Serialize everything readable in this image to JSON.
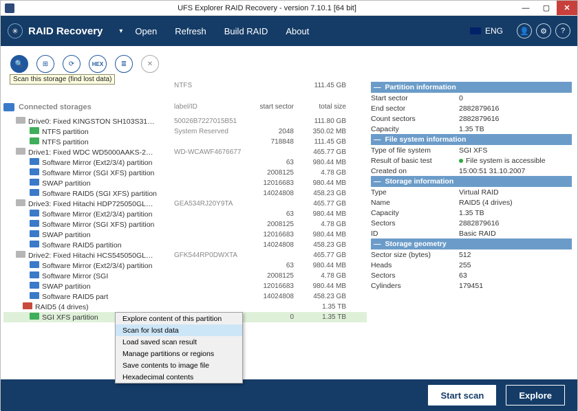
{
  "titlebar": {
    "title": "UFS Explorer RAID Recovery - version 7.10.1 [64 bit]"
  },
  "header": {
    "brand": "RAID Recovery",
    "menu": {
      "open": "Open",
      "refresh": "Refresh",
      "build": "Build RAID",
      "about": "About"
    },
    "lang": "ENG"
  },
  "tooltip": "Scan this storage (find lost data)",
  "tree": {
    "headers": {
      "label": "label/ID",
      "start": "start sector",
      "size": "total size"
    },
    "first_row": {
      "fs": "NTFS",
      "size": "111.45 GB"
    },
    "section": "Connected storages",
    "rows": [
      {
        "indent": "0",
        "ico": "ico-drive",
        "label": "Drive0: Fixed KINGSTON SH103S31…",
        "id": "50026B7227015B51",
        "start": "",
        "size": "111.80 GB"
      },
      {
        "indent": "1",
        "ico": "ico-part-g",
        "label": "NTFS partition",
        "id": "System Reserved",
        "start": "2048",
        "size": "350.02 MB"
      },
      {
        "indent": "1",
        "ico": "ico-part-g",
        "label": "NTFS partition",
        "id": "",
        "start": "718848",
        "size": "111.45 GB"
      },
      {
        "indent": "0",
        "ico": "ico-drive",
        "label": "Drive1: Fixed WDC WD5000AAKS-2…",
        "id": "WD-WCAWF4676677",
        "start": "",
        "size": "465.77 GB"
      },
      {
        "indent": "1",
        "ico": "ico-part-b",
        "label": "Software Mirror (Ext2/3/4) partition",
        "id": "",
        "start": "63",
        "size": "980.44 MB"
      },
      {
        "indent": "1",
        "ico": "ico-part-b",
        "label": "Software Mirror (SGI XFS) partition",
        "id": "",
        "start": "2008125",
        "size": "4.78 GB"
      },
      {
        "indent": "1",
        "ico": "ico-part-b",
        "label": "SWAP partition",
        "id": "",
        "start": "12016683",
        "size": "980.44 MB"
      },
      {
        "indent": "1",
        "ico": "ico-part-b",
        "label": "Software RAID5 (SGI XFS) partition",
        "id": "",
        "start": "14024808",
        "size": "458.23 GB"
      },
      {
        "indent": "0",
        "ico": "ico-drive",
        "label": "Drive3: Fixed Hitachi HDP725050GL…",
        "id": "GEA534RJ20Y9TA",
        "start": "",
        "size": "465.77 GB"
      },
      {
        "indent": "1",
        "ico": "ico-part-b",
        "label": "Software Mirror (Ext2/3/4) partition",
        "id": "",
        "start": "63",
        "size": "980.44 MB"
      },
      {
        "indent": "1",
        "ico": "ico-part-b",
        "label": "Software Mirror (SGI XFS) partition",
        "id": "",
        "start": "2008125",
        "size": "4.78 GB"
      },
      {
        "indent": "1",
        "ico": "ico-part-b",
        "label": "SWAP partition",
        "id": "",
        "start": "12016683",
        "size": "980.44 MB"
      },
      {
        "indent": "1",
        "ico": "ico-part-b",
        "label": "Software RAID5 partition",
        "id": "",
        "start": "14024808",
        "size": "458.23 GB"
      },
      {
        "indent": "0",
        "ico": "ico-drive",
        "label": "Drive2: Fixed Hitachi HCS545050GL…",
        "id": "GFK544RP0DWXTA",
        "start": "",
        "size": "465.77 GB"
      },
      {
        "indent": "1",
        "ico": "ico-part-b",
        "label": "Software Mirror (Ext2/3/4) partition",
        "id": "",
        "start": "63",
        "size": "980.44 MB"
      },
      {
        "indent": "1",
        "ico": "ico-part-b",
        "label": "Software Mirror (SGI",
        "id": "",
        "start": "2008125",
        "size": "4.78 GB"
      },
      {
        "indent": "1",
        "ico": "ico-part-b",
        "label": "SWAP partition",
        "id": "",
        "start": "12016683",
        "size": "980.44 MB"
      },
      {
        "indent": "1",
        "ico": "ico-part-b",
        "label": "Software RAID5 part",
        "id": "",
        "start": "14024808",
        "size": "458.23 GB"
      },
      {
        "indent": "1b",
        "ico": "ico-raid",
        "label": "RAID5 (4 drives)",
        "id": "",
        "start": "",
        "size": "1.35 TB"
      },
      {
        "indent": "1",
        "ico": "ico-part-g",
        "label": "SGI XFS partition",
        "id": "",
        "start": "0",
        "size": "1.35 TB",
        "sel": true
      }
    ]
  },
  "ctx": {
    "items": [
      "Explore content of this partition",
      "Scan for lost data",
      "Load saved scan result",
      "Manage partitions or regions",
      "Save contents to image file",
      "Hexadecimal contents"
    ],
    "hi_index": 1
  },
  "info": {
    "s0": "Partition information",
    "r0": [
      {
        "k": "Start sector",
        "v": "0"
      },
      {
        "k": "End sector",
        "v": "2882879616"
      },
      {
        "k": "Count sectors",
        "v": "2882879616"
      },
      {
        "k": "Capacity",
        "v": "1.35 TB"
      }
    ],
    "s1": "File system information",
    "r1": [
      {
        "k": "Type of file system",
        "v": "SGI XFS"
      },
      {
        "k": "Result of basic test",
        "v": "File system is accessible",
        "ok": true
      },
      {
        "k": "Created on",
        "v": "15:00:51 31.10.2007"
      }
    ],
    "s2": "Storage information",
    "r2": [
      {
        "k": "Type",
        "v": "Virtual RAID"
      },
      {
        "k": "Name",
        "v": "RAID5 (4 drives)"
      },
      {
        "k": "Capacity",
        "v": "1.35 TB"
      },
      {
        "k": "Sectors",
        "v": "2882879616"
      },
      {
        "k": "ID",
        "v": "Basic RAID"
      }
    ],
    "s3": "Storage geometry",
    "r3": [
      {
        "k": "Sector size (bytes)",
        "v": "512"
      },
      {
        "k": "Heads",
        "v": "255"
      },
      {
        "k": "Sectors",
        "v": "63"
      },
      {
        "k": "Cylinders",
        "v": "179451"
      }
    ]
  },
  "bottom": {
    "start": "Start scan",
    "explore": "Explore"
  }
}
